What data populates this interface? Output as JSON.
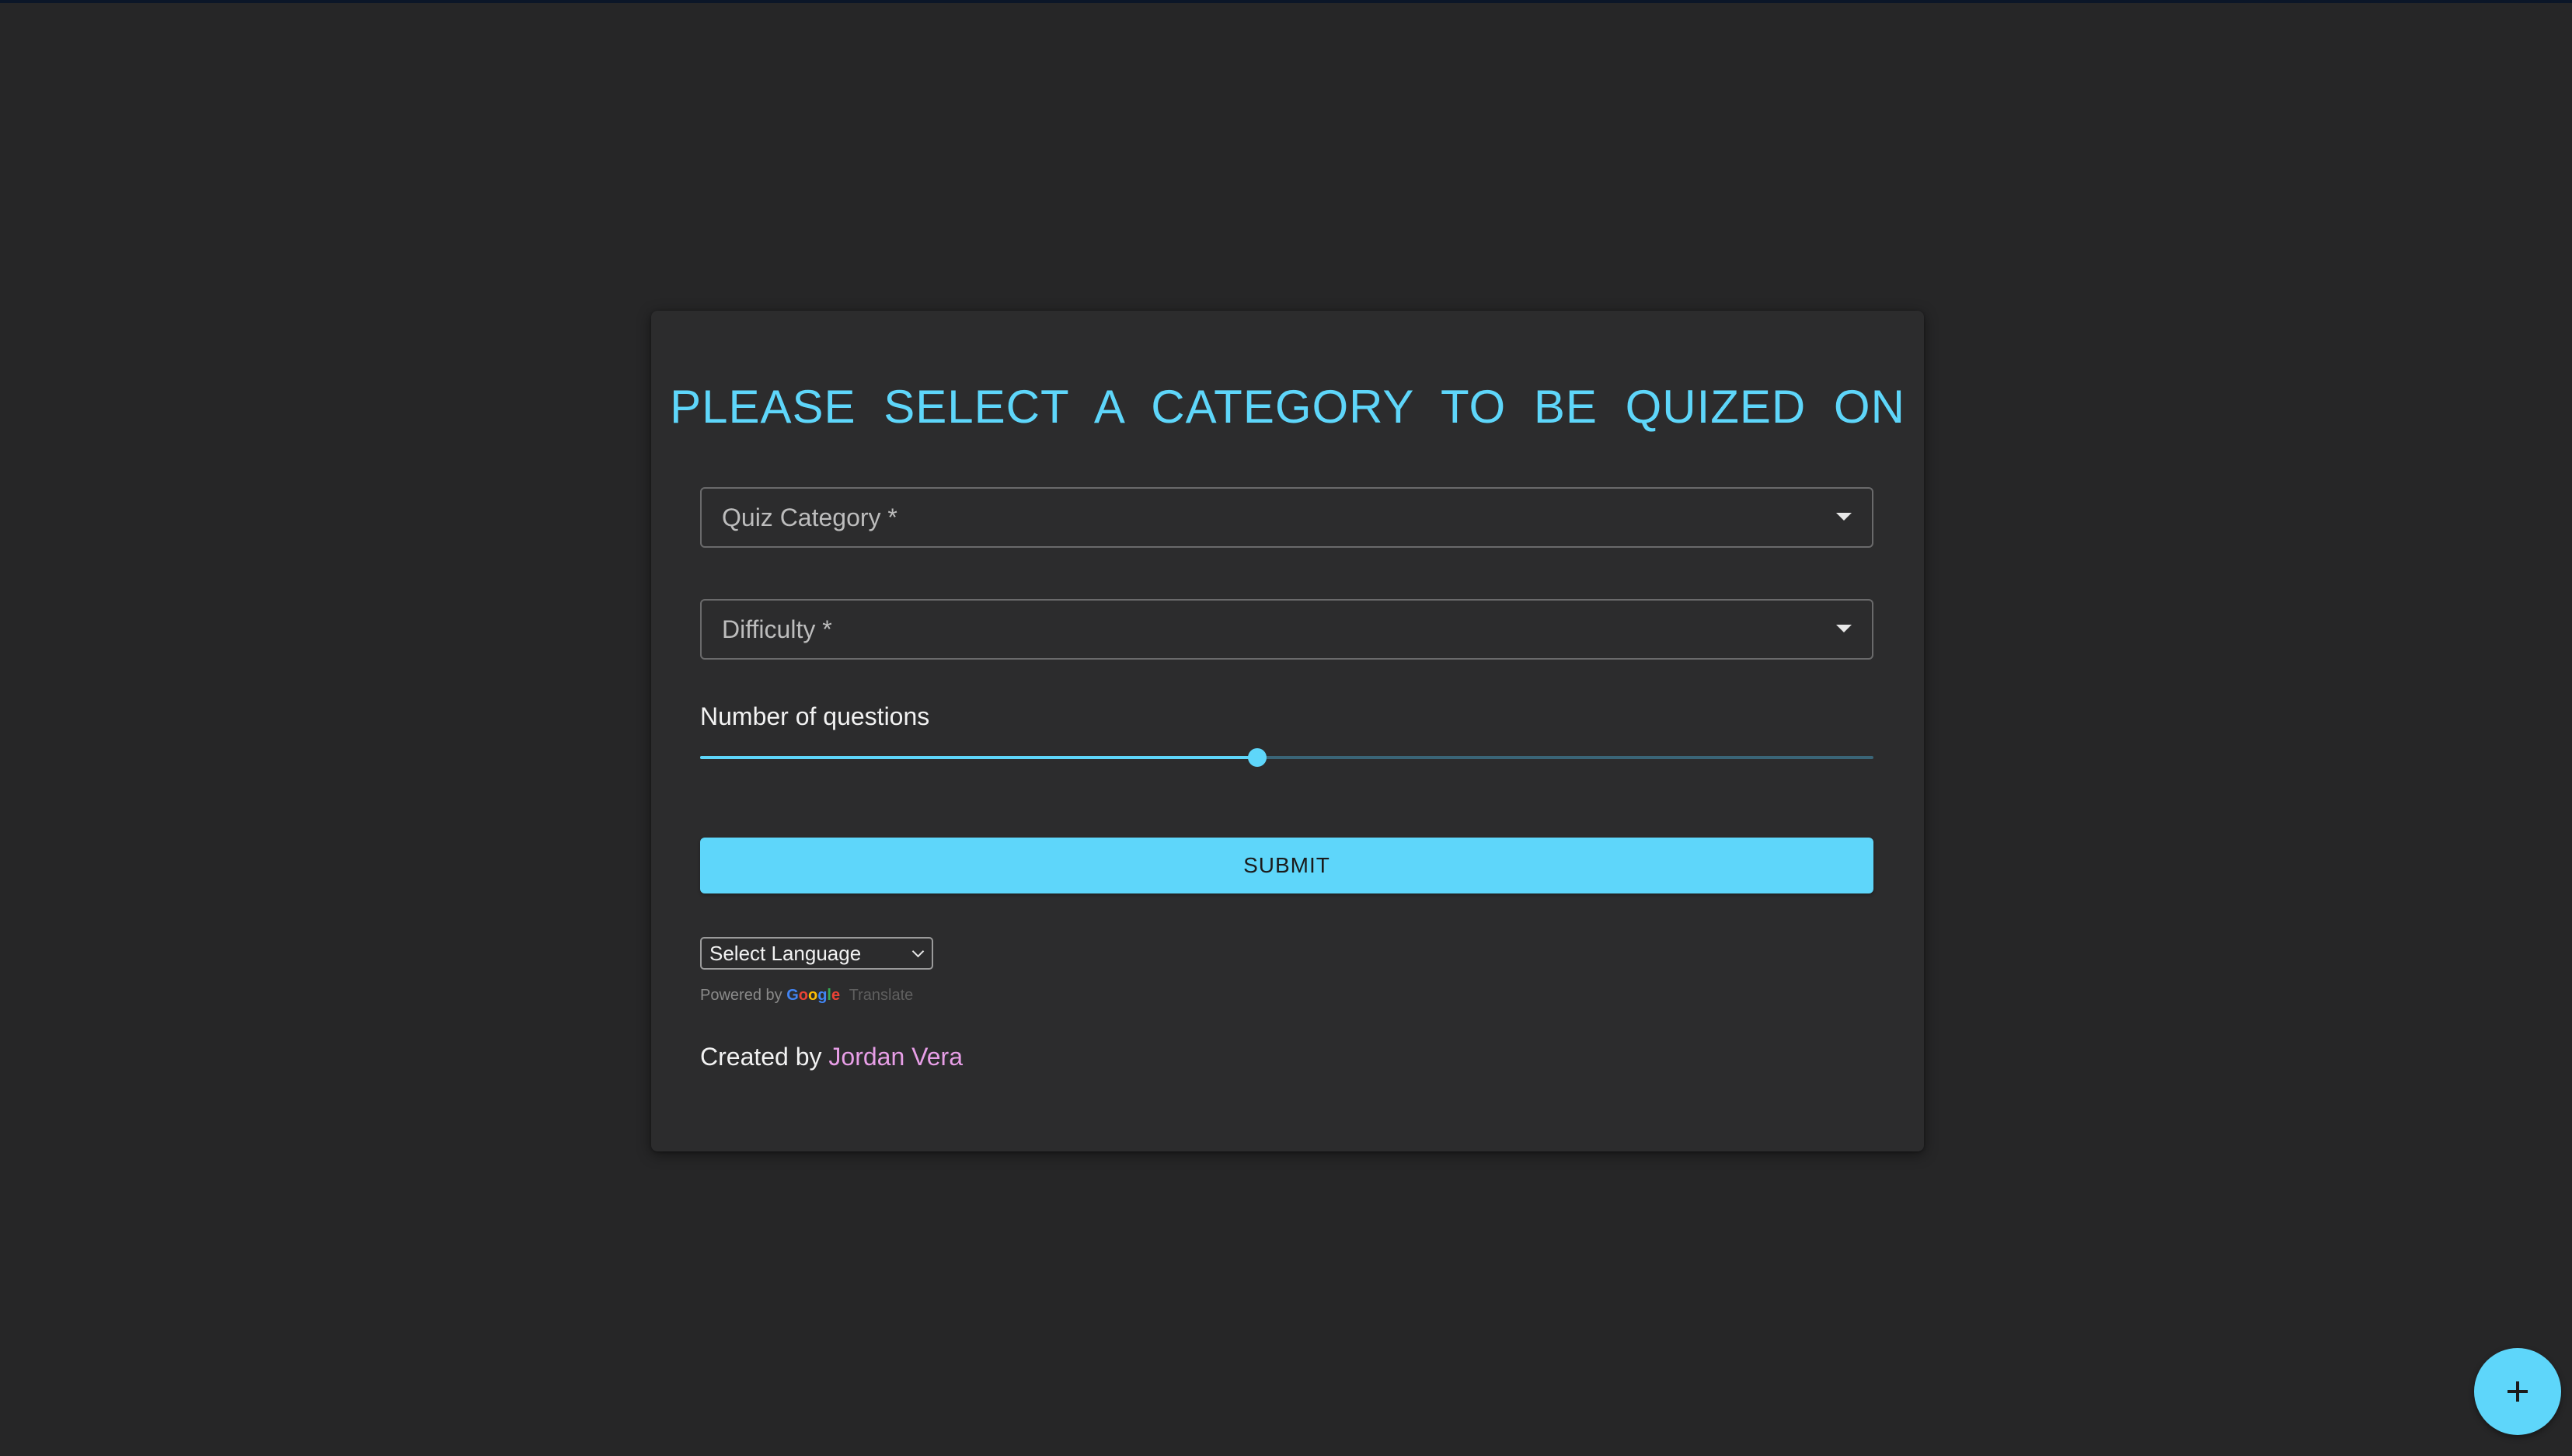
{
  "page": {
    "title": "PLEASE SELECT A CATEGORY TO BE QUIZED ON"
  },
  "form": {
    "category_label": "Quiz Category *",
    "difficulty_label": "Difficulty *",
    "questions_label": "Number of questions",
    "questions_slider_fraction": 0.475,
    "submit_label": "SUBMIT"
  },
  "translate": {
    "select_label": "Select Language",
    "powered_by": "Powered by",
    "google_letters": [
      "G",
      "o",
      "o",
      "g",
      "l",
      "e"
    ],
    "google_colors": [
      "#4285F4",
      "#EA4335",
      "#FBBC05",
      "#4285F4",
      "#34A853",
      "#EA4335"
    ],
    "translate_label": "Translate"
  },
  "footer": {
    "created_by": "Created by ",
    "author": "Jordan Vera"
  },
  "fab": {
    "icon": "plus-icon"
  },
  "colors": {
    "accent": "#5ed6fa",
    "background": "#262627",
    "card": "#2c2c2d",
    "author_link": "#e79ee6"
  }
}
